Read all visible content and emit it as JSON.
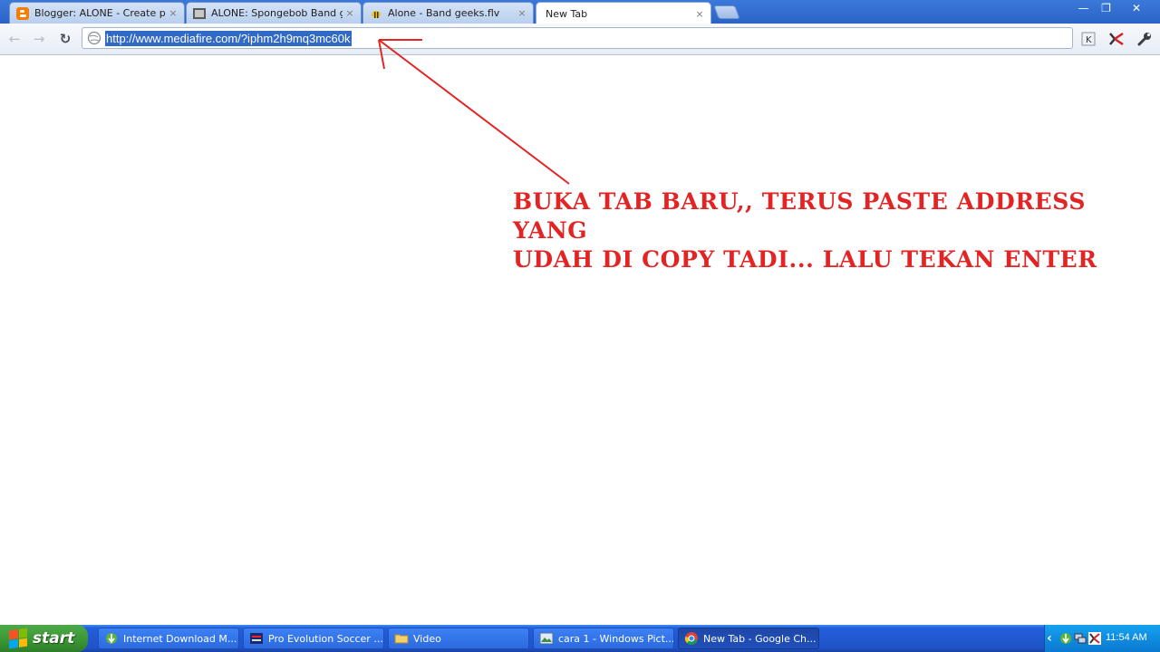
{
  "browser": {
    "tabs": [
      {
        "title": "Blogger: ALONE - Create post",
        "icon": "blogger-icon",
        "close": "×"
      },
      {
        "title": "ALONE: Spongebob Band geeks",
        "icon": "page-icon",
        "close": "×"
      },
      {
        "title": "Alone - Band geeks.flv",
        "icon": "bee-icon",
        "close": "×"
      },
      {
        "title": "New Tab",
        "icon": "",
        "close": "×",
        "active": true
      }
    ],
    "window_controls": {
      "minimize": "—",
      "restore": "❐",
      "close": "✕"
    },
    "nav": {
      "back": "←",
      "forward": "→",
      "reload": "↻"
    },
    "address": {
      "url": "http://www.mediafire.com/?iphm2h9mq3mc60k",
      "selected": true
    },
    "toolbar_right": {
      "k": "K",
      "tools": "🔧"
    }
  },
  "annotation": {
    "line1": "BUKA TAB BARU,, TERUS PASTE ADDRESS YANG",
    "line2": "UDAH DI COPY TADI... LALU TEKAN ENTER",
    "color": "#e32424"
  },
  "taskbar": {
    "start_label": "start",
    "buttons": [
      {
        "label": "Internet Download M...",
        "icon": "idm-icon"
      },
      {
        "label": "Pro Evolution Soccer ...",
        "icon": "pes-icon"
      },
      {
        "label": "Video",
        "icon": "folder-icon"
      },
      {
        "label": "cara 1 - Windows Pict...",
        "icon": "picture-viewer-icon"
      },
      {
        "label": "New Tab - Google Ch...",
        "icon": "chrome-icon",
        "active": true
      }
    ],
    "tray_chevron": "‹",
    "clock": "11:54 AM"
  }
}
